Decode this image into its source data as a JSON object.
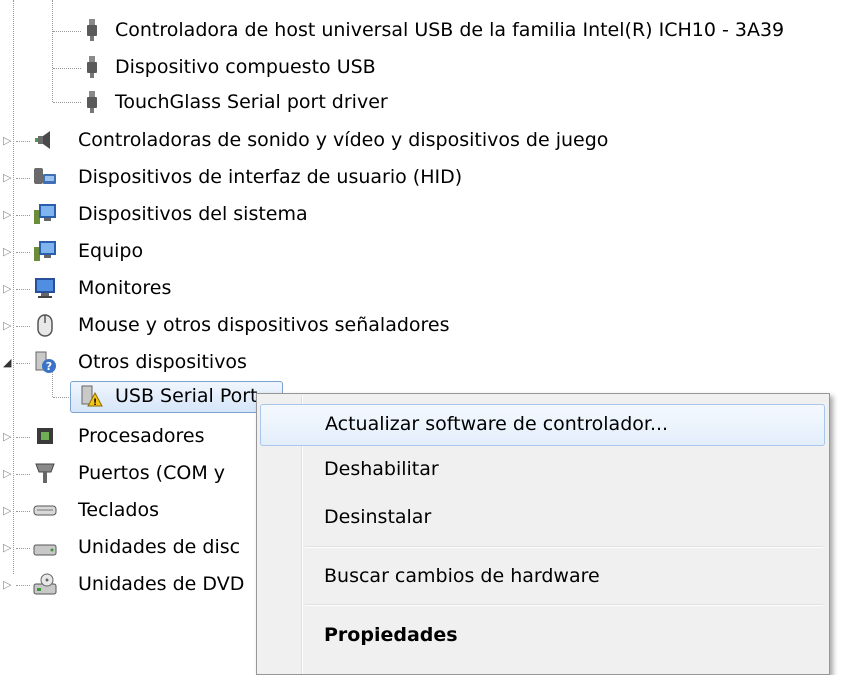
{
  "tree": {
    "usb_children": [
      "Controladora de host universal USB de la familia Intel(R) ICH10 - 3A39",
      "Dispositivo compuesto USB",
      "TouchGlass Serial port driver"
    ],
    "categories": [
      {
        "label": "Controladoras de sonido y vídeo y dispositivos de juego",
        "icon": "speaker-icon",
        "expanded": false
      },
      {
        "label": "Dispositivos de interfaz de usuario (HID)",
        "icon": "hid-icon",
        "expanded": false
      },
      {
        "label": "Dispositivos del sistema",
        "icon": "system-device-icon",
        "expanded": false
      },
      {
        "label": "Equipo",
        "icon": "computer-icon",
        "expanded": false
      },
      {
        "label": "Monitores",
        "icon": "monitor-icon",
        "expanded": false
      },
      {
        "label": "Mouse y otros dispositivos señaladores",
        "icon": "mouse-icon",
        "expanded": false
      },
      {
        "label": "Otros dispositivos",
        "icon": "unknown-device-icon",
        "expanded": true
      },
      {
        "label": "Procesadores",
        "icon": "processor-icon",
        "expanded": false
      },
      {
        "label": "Puertos (COM y",
        "icon": "port-icon",
        "expanded": false
      },
      {
        "label": "Teclados",
        "icon": "keyboard-icon",
        "expanded": false
      },
      {
        "label": "Unidades de disc",
        "icon": "disk-drive-icon",
        "expanded": false
      },
      {
        "label": "Unidades de DVD",
        "icon": "dvd-drive-icon",
        "expanded": false
      }
    ],
    "other_device_child": {
      "label": "USB Serial Port",
      "icon": "warning-device-icon"
    }
  },
  "context_menu": {
    "items": [
      {
        "label": "Actualizar software de controlador...",
        "highlighted": true,
        "bold": false
      },
      {
        "label": "Deshabilitar",
        "highlighted": false,
        "bold": false
      },
      {
        "label": "Desinstalar",
        "highlighted": false,
        "bold": false
      },
      {
        "label": "Buscar cambios de hardware",
        "highlighted": false,
        "bold": false
      },
      {
        "label": "Propiedades",
        "highlighted": false,
        "bold": true
      }
    ]
  },
  "colors": {
    "selection_border": "#7da2ce",
    "menu_background": "#f0f0f0",
    "menu_highlight_border": "#a8c7ea",
    "warning_yellow": "#f5c518"
  }
}
